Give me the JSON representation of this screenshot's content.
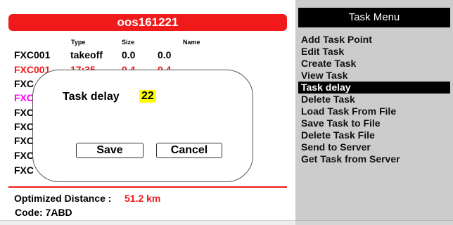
{
  "header": {
    "title": "oos161221"
  },
  "columns": {
    "type": "Type",
    "size": "Size",
    "name": "Name"
  },
  "task_points": [
    {
      "id": "FXC001",
      "type": "takeoff",
      "size": "0.0",
      "name": "0.0",
      "color": "#000000"
    },
    {
      "id": "FXC001",
      "type": "17:35",
      "size": "0.4",
      "name": "0.4",
      "color": "#f11a1a"
    },
    {
      "id": "FXC",
      "type": "",
      "size": "",
      "name": "",
      "color": "#000000"
    },
    {
      "id": "FXC",
      "type": "",
      "size": "",
      "name": "",
      "color": "#ff00ff"
    },
    {
      "id": "FXC",
      "type": "",
      "size": "",
      "name": "",
      "color": "#000000"
    },
    {
      "id": "FXC",
      "type": "",
      "size": "",
      "name": "",
      "color": "#000000"
    },
    {
      "id": "FXC",
      "type": "",
      "size": "",
      "name": "",
      "color": "#000000"
    },
    {
      "id": "FXC",
      "type": "",
      "size": "",
      "name": "",
      "color": "#000000"
    },
    {
      "id": "FXC",
      "type": "",
      "size": "",
      "name": "",
      "color": "#000000"
    }
  ],
  "footer": {
    "distance_label": "Optimized Distance :",
    "distance_value": "51.2 km",
    "code_label": "Code: 7ABD"
  },
  "dialog": {
    "label": "Task delay",
    "value": "22",
    "save_label": "Save",
    "cancel_label": "Cancel"
  },
  "menu": {
    "title": "Task Menu",
    "selected_index": 4,
    "items": [
      "Add Task Point",
      "Edit Task",
      "Create Task",
      "View Task",
      "Task delay",
      "Delete Task",
      "Load Task From File",
      "Save Task to File",
      "Delete Task File",
      "Send to Server",
      "Get Task from Server"
    ]
  },
  "colors": {
    "accent_red": "#f11a1a",
    "highlight_yellow": "#ffff00",
    "menu_background": "#cccccc"
  }
}
